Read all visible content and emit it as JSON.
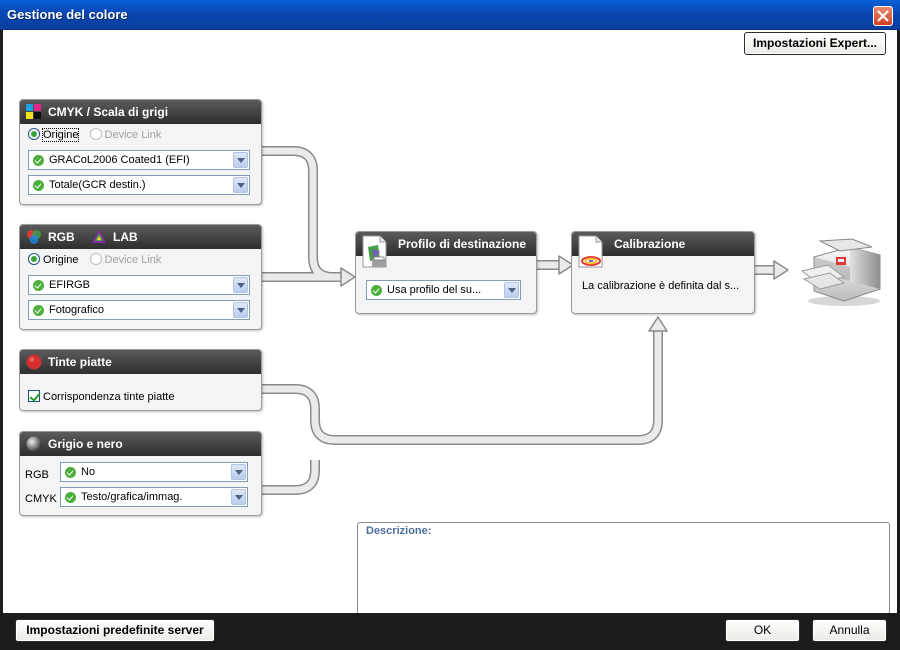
{
  "window": {
    "title": "Gestione del colore"
  },
  "toolbar": {
    "expert_label": "Impostazioni Expert..."
  },
  "cmyk": {
    "title": "CMYK / Scala di grigi",
    "radio_source": "Origine",
    "radio_devicelink": "Device Link",
    "profile": "GRACoL2006 Coated1 (EFI)",
    "rendering": "Totale(GCR destin.)"
  },
  "rgb": {
    "title_rgb": "RGB",
    "title_lab": "LAB",
    "radio_source": "Origine",
    "radio_devicelink": "Device Link",
    "profile": "EFIRGB",
    "rendering": "Fotografico"
  },
  "spot": {
    "title": "Tinte piatte",
    "match_label": "Corrispondenza tinte piatte",
    "match_checked": true
  },
  "gray": {
    "title": "Grigio e nero",
    "rgb_label": "RGB",
    "rgb_value": "No",
    "cmyk_label": "CMYK",
    "cmyk_value": "Testo/grafica/immag."
  },
  "destination": {
    "title": "Profilo di destinazione",
    "value": "Usa profilo del su..."
  },
  "calibration": {
    "title": "Calibrazione",
    "text": "La calibrazione è definita dal s..."
  },
  "description": {
    "label": "Descrizione:"
  },
  "footer": {
    "defaults_label": "Impostazioni predefinite server",
    "ok_label": "OK",
    "cancel_label": "Annulla"
  },
  "icons": {
    "close": "close-icon",
    "cmyk": "cmyk-swatch-icon",
    "rgb": "rgb-circles-icon",
    "lab": "lab-triangle-icon",
    "spot": "spot-color-icon",
    "gray": "gray-ball-icon",
    "destination": "printer-profile-icon",
    "calibration": "calibration-icon",
    "printer": "printer-icon"
  },
  "colors": {
    "titlebar": "#0846b3",
    "panel_header": "#3a3a3a",
    "connector": "#e6e6e6",
    "description_label": "#4d6f9a"
  }
}
